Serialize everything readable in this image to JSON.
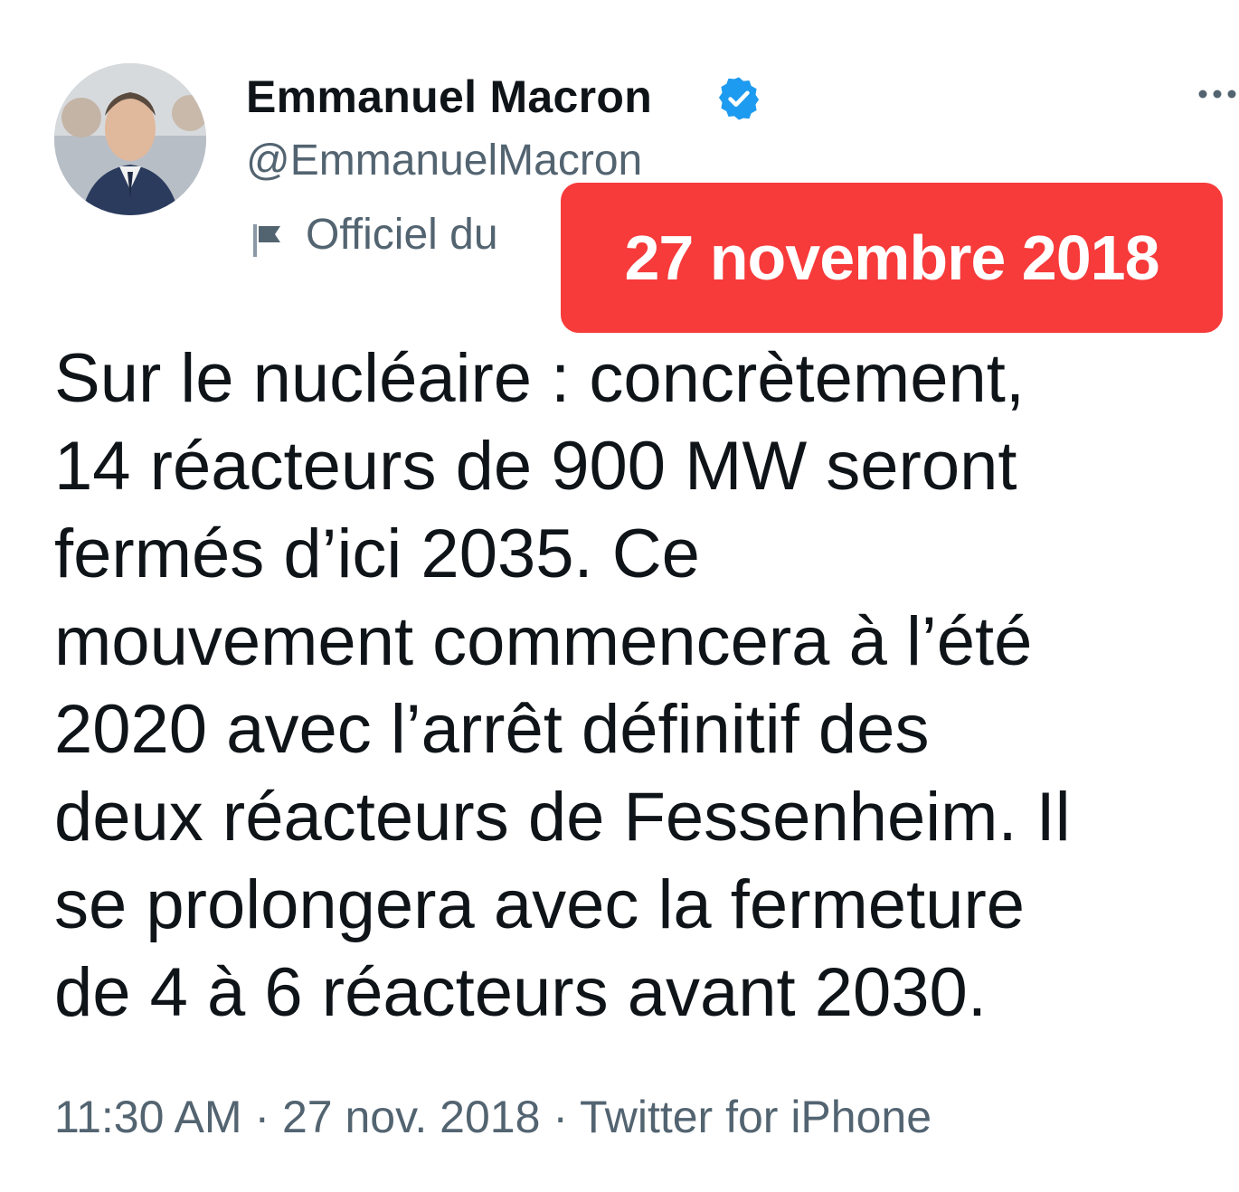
{
  "tweet": {
    "author": {
      "display_name": "Emmanuel Macron",
      "handle": "@EmmanuelMacron",
      "verified": true,
      "label": "Officiel du"
    },
    "date_banner": "27 novembre 2018",
    "text_lines": [
      "Sur le nucléaire : concrètement,",
      "14 réacteurs de 900 MW seront",
      "fermés d’ici 2035. Ce",
      "mouvement commencera à l’été",
      "2020 avec l’arrêt définitif des",
      "deux réacteurs de Fessenheim. Il",
      "se prolongera avec la fermeture",
      "de 4 à 6 réacteurs avant 2030."
    ],
    "meta": {
      "time": "11:30 AM",
      "separator": " · ",
      "date": "27 nov. 2018",
      "source": "Twitter for iPhone"
    }
  },
  "icons": {
    "verified": "verified-badge-icon",
    "flag": "flag-icon",
    "more": "more-horizontal-icon"
  },
  "colors": {
    "verified_blue": "#1d9bf0",
    "banner_red": "#f73a3a",
    "text_primary": "#0f1419",
    "text_secondary": "#536471"
  }
}
